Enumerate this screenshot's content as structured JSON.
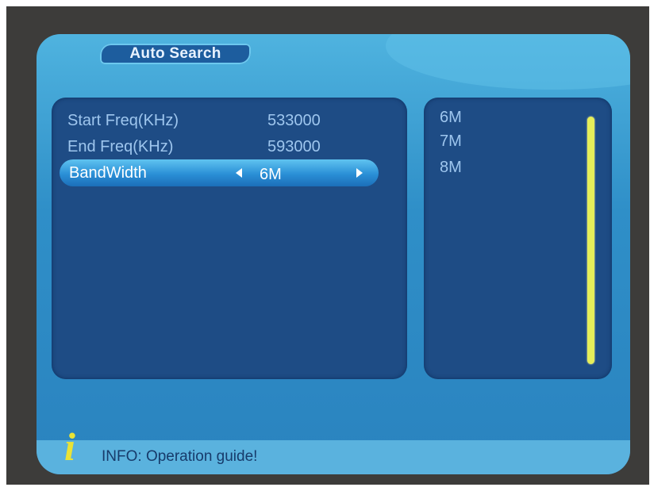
{
  "title": "Auto Search",
  "fields": [
    {
      "label": "Start Freq(KHz)",
      "value": "533000"
    },
    {
      "label": "End Freq(KHz)",
      "value": "593000"
    }
  ],
  "selected_field": {
    "label": "BandWidth",
    "value": "6M"
  },
  "bandwidth_options": [
    "6M",
    "7M",
    "8M"
  ],
  "info_text": "INFO: Operation guide!",
  "info_icon": "info-icon",
  "colors": {
    "panel": "#2f8fc8",
    "box": "#1e4c85",
    "highlight": "#2a8fd6",
    "scrollbar": "#e6ef5a",
    "info_icon": "#e9e336"
  }
}
